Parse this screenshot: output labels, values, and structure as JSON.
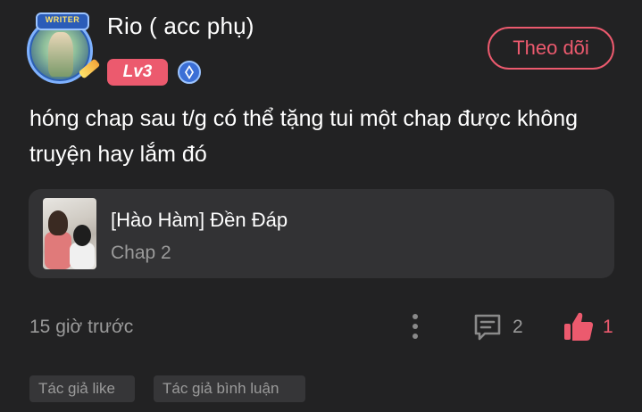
{
  "user": {
    "name": "Rio ( acc phụ)",
    "avatar_badge": "WRITER",
    "level": "Lv3",
    "verify_icon": "diamond-badge-icon"
  },
  "follow_button": "Theo dõi",
  "comment_text": "hóng chap sau t/g có thể tặng tui một chap được không truyện hay lắm đó",
  "chapter_card": {
    "title": "[Hào Hàm] Đền Đáp",
    "subtitle": "Chap 2"
  },
  "footer": {
    "time": "15 giờ trước",
    "more_icon": "more-vertical-icon",
    "reply_icon": "comment-icon",
    "reply_count": "2",
    "like_icon": "thumbs-up-icon",
    "like_count": "1"
  },
  "tags": [
    "Tác giả like",
    "Tác giả bình luận"
  ],
  "colors": {
    "background": "#222223",
    "accent": "#ec5a6e",
    "card": "#323234",
    "muted_text": "#9a9a9a"
  }
}
